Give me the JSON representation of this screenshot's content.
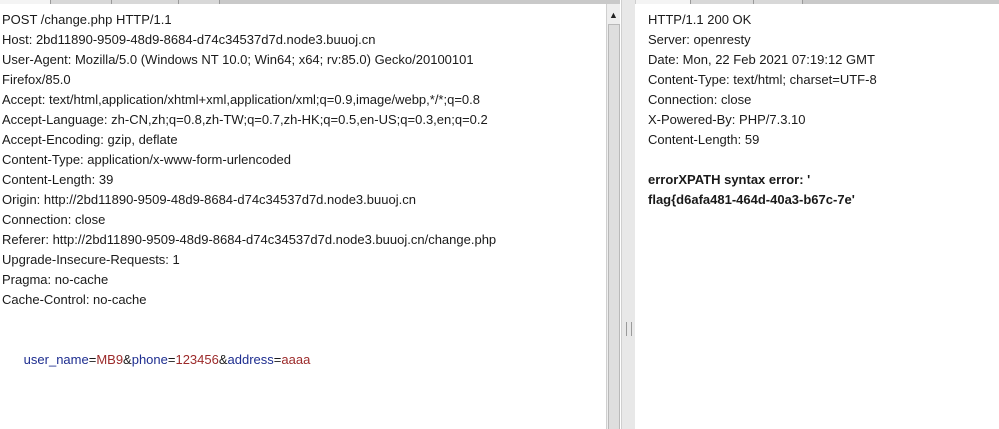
{
  "request": {
    "headers": [
      "POST /change.php HTTP/1.1",
      "Host: 2bd11890-9509-48d9-8684-d74c34537d7d.node3.buuoj.cn",
      "User-Agent: Mozilla/5.0 (Windows NT 10.0; Win64; x64; rv:85.0) Gecko/20100101",
      "Firefox/85.0",
      "Accept: text/html,application/xhtml+xml,application/xml;q=0.9,image/webp,*/*;q=0.8",
      "Accept-Language: zh-CN,zh;q=0.8,zh-TW;q=0.7,zh-HK;q=0.5,en-US;q=0.3,en;q=0.2",
      "Accept-Encoding: gzip, deflate",
      "Content-Type: application/x-www-form-urlencoded",
      "Content-Length: 39",
      "Origin: http://2bd11890-9509-48d9-8684-d74c34537d7d.node3.buuoj.cn",
      "Connection: close",
      "Referer: http://2bd11890-9509-48d9-8684-d74c34537d7d.node3.buuoj.cn/change.php",
      "Upgrade-Insecure-Requests: 1",
      "Pragma: no-cache",
      "Cache-Control: no-cache"
    ],
    "body_params": [
      {
        "name": "user_name",
        "value": "MB9"
      },
      {
        "name": "phone",
        "value": "123456"
      },
      {
        "name": "address",
        "value": "aaaa"
      }
    ],
    "eq": "=",
    "amp": "&"
  },
  "response": {
    "headers": [
      "HTTP/1.1 200 OK",
      "Server: openresty",
      "Date: Mon, 22 Feb 2021 07:19:12 GMT",
      "Content-Type: text/html; charset=UTF-8",
      "Connection: close",
      "X-Powered-By: PHP/7.3.10",
      "Content-Length: 59"
    ],
    "body_lines": [
      "errorXPATH syntax error: '",
      "flag{d6afa481-464d-40a3-b67c-7e'"
    ]
  },
  "scrollbar": {
    "up_arrow": "▲"
  }
}
